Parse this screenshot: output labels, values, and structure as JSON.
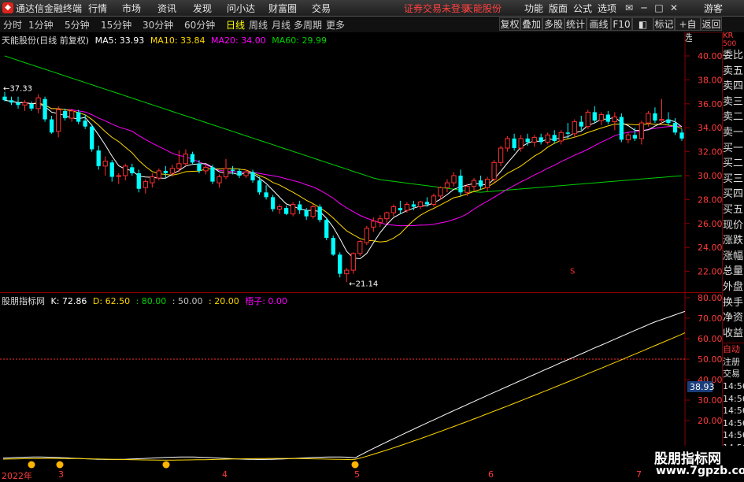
{
  "titlebar": {
    "app_name": "通达信金融终端",
    "menu": [
      "行情",
      "市场",
      "资讯",
      "发现",
      "问小达",
      "财富圈",
      "交易"
    ],
    "login_notice": "证券交易未登录",
    "stock_name": "天能股份",
    "right_menu": [
      "功能",
      "版面",
      "公式",
      "选项"
    ],
    "guest": "游客"
  },
  "toolbar": {
    "periods": [
      "分时",
      "1分钟",
      "5分钟",
      "15分钟",
      "30分钟",
      "60分钟",
      "日线",
      "周线",
      "月线",
      "多周期",
      "更多"
    ],
    "active_period": "日线",
    "buttons": [
      "复权",
      "叠加",
      "多股",
      "统计",
      "画线",
      "F10",
      "标记",
      "+自选",
      "返回"
    ]
  },
  "main_chart": {
    "title": "天能股份(日线 前复权)",
    "ma": [
      {
        "label": "MA5: 33.93",
        "color": "#ffffff"
      },
      {
        "label": "MA10: 33.84",
        "color": "#ffd700"
      },
      {
        "label": "MA20: 34.00",
        "color": "#ff00ff"
      },
      {
        "label": "MA60: 29.99",
        "color": "#00d000"
      }
    ],
    "high_label": "37.33",
    "low_label": "21.14",
    "marker": "S",
    "y_ticks": [
      "40.00",
      "38.00",
      "36.00",
      "34.00",
      "32.00",
      "30.00",
      "28.00",
      "26.00",
      "24.00",
      "22.00"
    ]
  },
  "indicator": {
    "title": "股朋指标网",
    "values": [
      {
        "label": "K: 72.86",
        "color": "#ffffff"
      },
      {
        "label": "D: 62.50",
        "color": "#ffd700"
      },
      {
        "label": ": 80.00",
        "color": "#00d000"
      },
      {
        "label": ": 50.00",
        "color": "#c0c0c0"
      },
      {
        "label": ": 20.00",
        "color": "#ffd700"
      },
      {
        "label": "梧子: 0.00",
        "color": "#ff00ff"
      }
    ],
    "y_ticks": [
      "80.00",
      "70.00",
      "60.00",
      "50.00",
      "40.00",
      "30.00",
      "20.00"
    ],
    "current_value": "38.93"
  },
  "right_panel": {
    "header_top": "KR",
    "header_sub": "500",
    "items": [
      "委比",
      "卖五",
      "卖四",
      "卖三",
      "卖二",
      "卖一",
      "买一",
      "买二",
      "买三",
      "买四",
      "买五",
      "现价",
      "涨跌",
      "涨幅",
      "总量",
      "外盘",
      "换手",
      "净资",
      "收益"
    ],
    "bottom_items": [
      "自动",
      "注册",
      "交易",
      "14:56",
      "14:56",
      "14:56",
      "14:56",
      "14:56",
      "14:56",
      "14:56",
      "14:56",
      "14:56"
    ]
  },
  "date_axis": {
    "labels": [
      "2022年",
      "3",
      "4",
      "5",
      "6",
      "7"
    ]
  },
  "watermark": {
    "line1": "股朋指标网",
    "line2": "www.7gpzb.com"
  },
  "chart_data": {
    "type": "candlestick",
    "candles": [
      [
        36.6,
        37.0,
        36.2,
        36.3
      ],
      [
        36.3,
        36.6,
        35.9,
        36.1
      ],
      [
        36.1,
        36.6,
        35.6,
        35.9
      ],
      [
        35.9,
        36.3,
        35.4,
        36.1
      ],
      [
        36.0,
        36.2,
        35.4,
        35.6
      ],
      [
        35.6,
        36.8,
        35.2,
        36.5
      ],
      [
        36.4,
        36.6,
        34.5,
        34.7
      ],
      [
        34.7,
        35.0,
        33.5,
        33.6
      ],
      [
        33.7,
        35.8,
        33.2,
        35.5
      ],
      [
        35.4,
        35.6,
        34.6,
        34.8
      ],
      [
        34.8,
        35.6,
        34.5,
        35.4
      ],
      [
        35.3,
        35.5,
        34.3,
        34.5
      ],
      [
        34.6,
        35.1,
        33.9,
        34.1
      ],
      [
        34.1,
        34.3,
        32.0,
        32.2
      ],
      [
        32.1,
        32.5,
        30.5,
        30.8
      ],
      [
        30.8,
        31.6,
        30.0,
        31.2
      ],
      [
        31.1,
        31.3,
        29.5,
        29.9
      ],
      [
        30.0,
        30.2,
        29.3,
        30.0
      ],
      [
        30.0,
        31.0,
        29.6,
        30.8
      ],
      [
        30.7,
        31.0,
        30.0,
        30.2
      ],
      [
        30.2,
        30.5,
        28.6,
        28.9
      ],
      [
        29.0,
        29.7,
        28.5,
        29.5
      ],
      [
        29.4,
        30.2,
        29.0,
        29.9
      ],
      [
        29.8,
        30.6,
        29.6,
        30.4
      ],
      [
        30.4,
        30.8,
        29.8,
        30.2
      ],
      [
        30.2,
        30.9,
        29.9,
        30.6
      ],
      [
        30.6,
        32.1,
        30.3,
        31.0
      ],
      [
        31.0,
        32.2,
        30.8,
        31.8
      ],
      [
        31.8,
        32.0,
        30.9,
        31.1
      ],
      [
        31.0,
        31.3,
        30.2,
        30.4
      ],
      [
        30.4,
        30.9,
        30.1,
        30.7
      ],
      [
        30.7,
        30.9,
        29.3,
        29.5
      ],
      [
        29.4,
        30.1,
        29.0,
        29.9
      ],
      [
        29.9,
        31.4,
        29.7,
        30.6
      ],
      [
        30.5,
        30.8,
        30.1,
        30.4
      ],
      [
        30.4,
        30.6,
        29.8,
        30.0
      ],
      [
        30.0,
        30.5,
        29.8,
        30.3
      ],
      [
        30.3,
        30.5,
        29.4,
        29.6
      ],
      [
        29.6,
        29.9,
        28.4,
        28.6
      ],
      [
        28.6,
        29.2,
        28.0,
        28.2
      ],
      [
        28.2,
        28.4,
        27.0,
        27.2
      ],
      [
        27.2,
        27.6,
        26.8,
        27.4
      ],
      [
        27.3,
        27.5,
        26.7,
        26.8
      ],
      [
        26.8,
        27.8,
        26.6,
        27.6
      ],
      [
        27.6,
        27.9,
        26.8,
        27.1
      ],
      [
        27.1,
        27.3,
        26.3,
        26.6
      ],
      [
        26.6,
        27.6,
        26.4,
        27.4
      ],
      [
        27.4,
        27.6,
        26.1,
        26.3
      ],
      [
        26.3,
        26.5,
        24.6,
        24.8
      ],
      [
        24.8,
        25.0,
        23.3,
        23.4
      ],
      [
        23.4,
        23.6,
        21.5,
        21.8
      ],
      [
        21.8,
        22.3,
        21.1,
        22.1
      ],
      [
        22.1,
        23.6,
        21.8,
        23.5
      ],
      [
        23.5,
        24.6,
        23.3,
        24.5
      ],
      [
        24.4,
        25.8,
        24.2,
        25.6
      ],
      [
        25.7,
        26.5,
        25.3,
        26.2
      ],
      [
        26.1,
        26.7,
        25.7,
        26.4
      ],
      [
        26.4,
        27.0,
        26.0,
        26.9
      ],
      [
        26.9,
        27.6,
        26.6,
        27.4
      ],
      [
        27.3,
        27.9,
        26.8,
        27.1
      ],
      [
        27.1,
        27.8,
        26.9,
        27.6
      ],
      [
        27.6,
        27.9,
        27.1,
        27.4
      ],
      [
        27.4,
        27.9,
        27.2,
        27.8
      ],
      [
        27.8,
        28.2,
        27.4,
        27.6
      ],
      [
        27.6,
        28.5,
        27.4,
        28.3
      ],
      [
        28.3,
        29.1,
        28.0,
        29.0
      ],
      [
        29.0,
        29.7,
        28.6,
        29.4
      ],
      [
        29.4,
        30.3,
        29.1,
        30.0
      ],
      [
        30.0,
        30.5,
        28.3,
        28.6
      ],
      [
        28.6,
        29.3,
        28.3,
        29.1
      ],
      [
        29.1,
        29.8,
        28.7,
        29.6
      ],
      [
        29.6,
        30.0,
        28.8,
        29.1
      ],
      [
        29.0,
        29.9,
        28.7,
        29.7
      ],
      [
        29.7,
        31.3,
        29.4,
        31.1
      ],
      [
        31.1,
        32.5,
        30.8,
        32.3
      ],
      [
        32.3,
        33.3,
        32.0,
        33.1
      ],
      [
        33.1,
        33.5,
        32.1,
        32.3
      ],
      [
        32.3,
        33.4,
        32.0,
        33.1
      ],
      [
        33.1,
        33.5,
        32.5,
        32.8
      ],
      [
        32.8,
        33.4,
        32.4,
        33.2
      ],
      [
        33.2,
        33.5,
        32.6,
        32.8
      ],
      [
        32.8,
        33.6,
        32.6,
        33.4
      ],
      [
        33.4,
        33.8,
        32.7,
        32.9
      ],
      [
        32.9,
        33.8,
        32.6,
        33.6
      ],
      [
        33.6,
        34.4,
        33.1,
        33.5
      ],
      [
        33.5,
        34.7,
        33.2,
        34.5
      ],
      [
        34.5,
        35.0,
        33.8,
        34.1
      ],
      [
        34.1,
        35.5,
        33.9,
        35.3
      ],
      [
        35.3,
        35.8,
        34.4,
        34.6
      ],
      [
        34.6,
        35.3,
        34.2,
        35.1
      ],
      [
        35.1,
        35.4,
        34.3,
        34.5
      ],
      [
        34.5,
        35.3,
        33.8,
        34.9
      ],
      [
        34.9,
        35.2,
        32.8,
        33.0
      ],
      [
        33.0,
        33.6,
        32.7,
        33.4
      ],
      [
        33.4,
        34.0,
        32.9,
        33.1
      ],
      [
        33.1,
        34.6,
        32.6,
        34.4
      ],
      [
        34.4,
        35.4,
        34.1,
        35.2
      ],
      [
        35.2,
        35.7,
        34.4,
        34.6
      ],
      [
        34.6,
        36.4,
        34.3,
        34.7
      ],
      [
        34.7,
        35.3,
        34.2,
        34.4
      ],
      [
        34.4,
        34.8,
        33.4,
        33.6
      ],
      [
        33.6,
        33.9,
        32.9,
        33.1
      ]
    ],
    "kdj_k_start": 0,
    "kdj_k_end": 72.86,
    "kdj_d_end": 62.5,
    "ma5": 33.93,
    "ma10": 33.84,
    "ma20": 34.0,
    "ma60": 29.99,
    "y_range": [
      21,
      41
    ],
    "ind_range": [
      0,
      85
    ]
  }
}
